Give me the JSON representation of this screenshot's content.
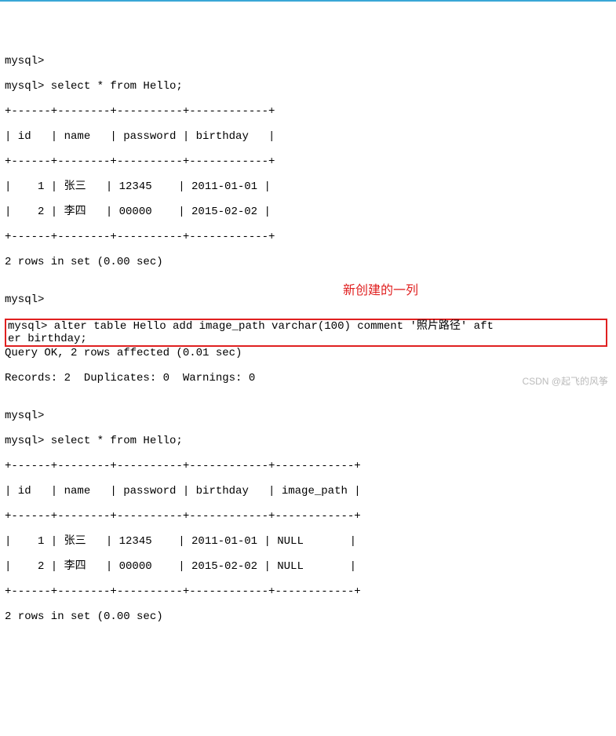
{
  "lines": {
    "l0": "mysql>",
    "l1": "mysql> select * from Hello;",
    "l2": "+------+--------+----------+------------+",
    "l3": "| id   | name   | password | birthday   |",
    "l4": "+------+--------+----------+------------+",
    "l5": "|    1 | 张三   | 12345    | 2011-01-01 |",
    "l6": "|    2 | 李四   | 00000    | 2015-02-02 |",
    "l7": "+------+--------+----------+------------+",
    "l8": "2 rows in set (0.00 sec)",
    "blank": "",
    "l9": "mysql>",
    "alter1": "mysql> alter table Hello add image_path varchar(100) comment '照片路径' aft",
    "alter2": "er birthday;",
    "l10": "Query OK, 2 rows affected (0.01 sec)",
    "l11": "Records: 2  Duplicates: 0  Warnings: 0",
    "l12": "mysql>",
    "l13": "mysql> select * from Hello;",
    "l14": "+------+--------+----------+------------+------------+",
    "l15": "| id   | name   | password | birthday   | image_path |",
    "l16": "+------+--------+----------+------------+------------+",
    "l17": "|    1 | 张三   | 12345    | 2011-01-01 | NULL       |",
    "l18": "|    2 | 李四   | 00000    | 2015-02-02 | NULL       |",
    "l19": "+------+--------+----------+------------+------------+",
    "l20": "2 rows in set (0.00 sec)"
  },
  "annotation": {
    "new_column_label": "新创建的一列"
  },
  "watermark": "CSDN @起飞的风筝",
  "table1": {
    "columns": [
      "id",
      "name",
      "password",
      "birthday"
    ],
    "rows": [
      {
        "id": 1,
        "name": "张三",
        "password": "12345",
        "birthday": "2011-01-01"
      },
      {
        "id": 2,
        "name": "李四",
        "password": "00000",
        "birthday": "2015-02-02"
      }
    ],
    "summary": "2 rows in set (0.00 sec)"
  },
  "alter_statement": "alter table Hello add image_path varchar(100) comment '照片路径' after birthday;",
  "alter_result": {
    "ok": "Query OK, 2 rows affected (0.01 sec)",
    "records": 2,
    "duplicates": 0,
    "warnings": 0
  },
  "table2": {
    "columns": [
      "id",
      "name",
      "password",
      "birthday",
      "image_path"
    ],
    "rows": [
      {
        "id": 1,
        "name": "张三",
        "password": "12345",
        "birthday": "2011-01-01",
        "image_path": "NULL"
      },
      {
        "id": 2,
        "name": "李四",
        "password": "00000",
        "birthday": "2015-02-02",
        "image_path": "NULL"
      }
    ],
    "summary": "2 rows in set (0.00 sec)"
  }
}
